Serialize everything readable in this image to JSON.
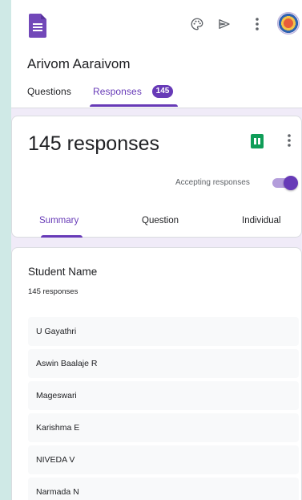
{
  "form": {
    "title": "Arivom Aaraivom"
  },
  "tabs": {
    "questions": "Questions",
    "responses": "Responses",
    "responses_badge": "145"
  },
  "summary": {
    "count_label": "145 responses",
    "accepting_label": "Accepting responses",
    "accepting": true,
    "sub_tabs": [
      "Summary",
      "Question",
      "Individual"
    ],
    "active_sub_tab": "Summary"
  },
  "question": {
    "title": "Student Name",
    "response_count": "145 responses",
    "answers": [
      "U Gayathri",
      "Aswin Baalaje R",
      "Mageswari",
      "Karishma E",
      "NIVEDA V",
      "Narmada N"
    ]
  },
  "icons": {
    "logo": "forms-logo-icon",
    "palette": "palette-icon",
    "send": "send-icon",
    "more": "more-vert-icon",
    "sheets": "sheets-icon"
  },
  "colors": {
    "accent": "#673ab7",
    "background": "#f0ebf8",
    "sheets_green": "#0f9d58",
    "outer_background": "#cfe9e6"
  }
}
